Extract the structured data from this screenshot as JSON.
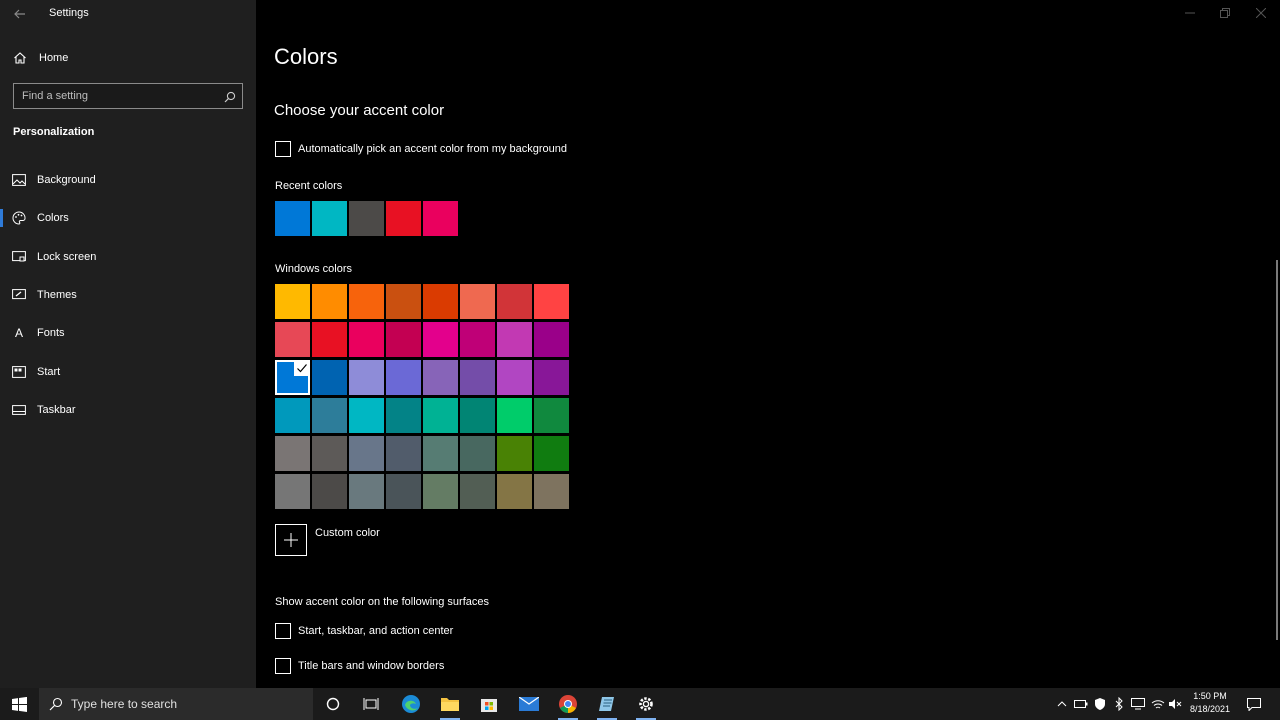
{
  "window": {
    "title": "Settings"
  },
  "sidebar": {
    "home_label": "Home",
    "search_placeholder": "Find a setting",
    "section": "Personalization",
    "items": [
      {
        "label": "Background",
        "icon": "picture-icon"
      },
      {
        "label": "Colors",
        "icon": "palette-icon",
        "selected": true
      },
      {
        "label": "Lock screen",
        "icon": "lock-screen-icon"
      },
      {
        "label": "Themes",
        "icon": "brush-icon"
      },
      {
        "label": "Fonts",
        "icon": "font-icon"
      },
      {
        "label": "Start",
        "icon": "start-icon"
      },
      {
        "label": "Taskbar",
        "icon": "taskbar-icon"
      }
    ]
  },
  "main": {
    "title": "Colors",
    "subtitle": "Choose your accent color",
    "auto_pick_label": "Automatically pick an accent color from my background",
    "recent_label": "Recent colors",
    "recent_colors": [
      "#0078d7",
      "#00b7c3",
      "#4c4a48",
      "#e81123",
      "#ea005e"
    ],
    "windows_label": "Windows colors",
    "windows_colors": [
      [
        "#ffb900",
        "#ff8c00",
        "#f7630c",
        "#ca5010",
        "#da3b01",
        "#ef6950",
        "#d13438",
        "#ff4343"
      ],
      [
        "#e74856",
        "#e81123",
        "#ea005e",
        "#c30052",
        "#e3008c",
        "#bf0077",
        "#c239b3",
        "#9a0089"
      ],
      [
        "#0078d7",
        "#0063b1",
        "#8e8cd8",
        "#6b69d6",
        "#8764b8",
        "#744da9",
        "#b146c2",
        "#881798"
      ],
      [
        "#0099bc",
        "#2d7d9a",
        "#00b7c3",
        "#038387",
        "#00b294",
        "#018574",
        "#00cc6a",
        "#10893e"
      ],
      [
        "#7a7574",
        "#5d5a58",
        "#68768a",
        "#515c6b",
        "#567c73",
        "#486860",
        "#498205",
        "#107c10"
      ],
      [
        "#767676",
        "#4c4a48",
        "#69797e",
        "#4a5459",
        "#647c64",
        "#525e54",
        "#847545",
        "#7e735f"
      ]
    ],
    "selected_color": "#0078d7",
    "custom_label": "Custom color",
    "surfaces_label": "Show accent color on the following surfaces",
    "surface_start_label": "Start, taskbar, and action center",
    "surface_title_label": "Title bars and window borders"
  },
  "taskbar": {
    "search_placeholder": "Type here to search",
    "apps": [
      "cortana-icon",
      "task-view-icon",
      "edge-icon",
      "file-explorer-icon",
      "store-icon",
      "mail-icon",
      "chrome-icon",
      "notepad-icon",
      "settings-icon"
    ],
    "time": "1:50 PM",
    "date": "8/18/2021"
  }
}
